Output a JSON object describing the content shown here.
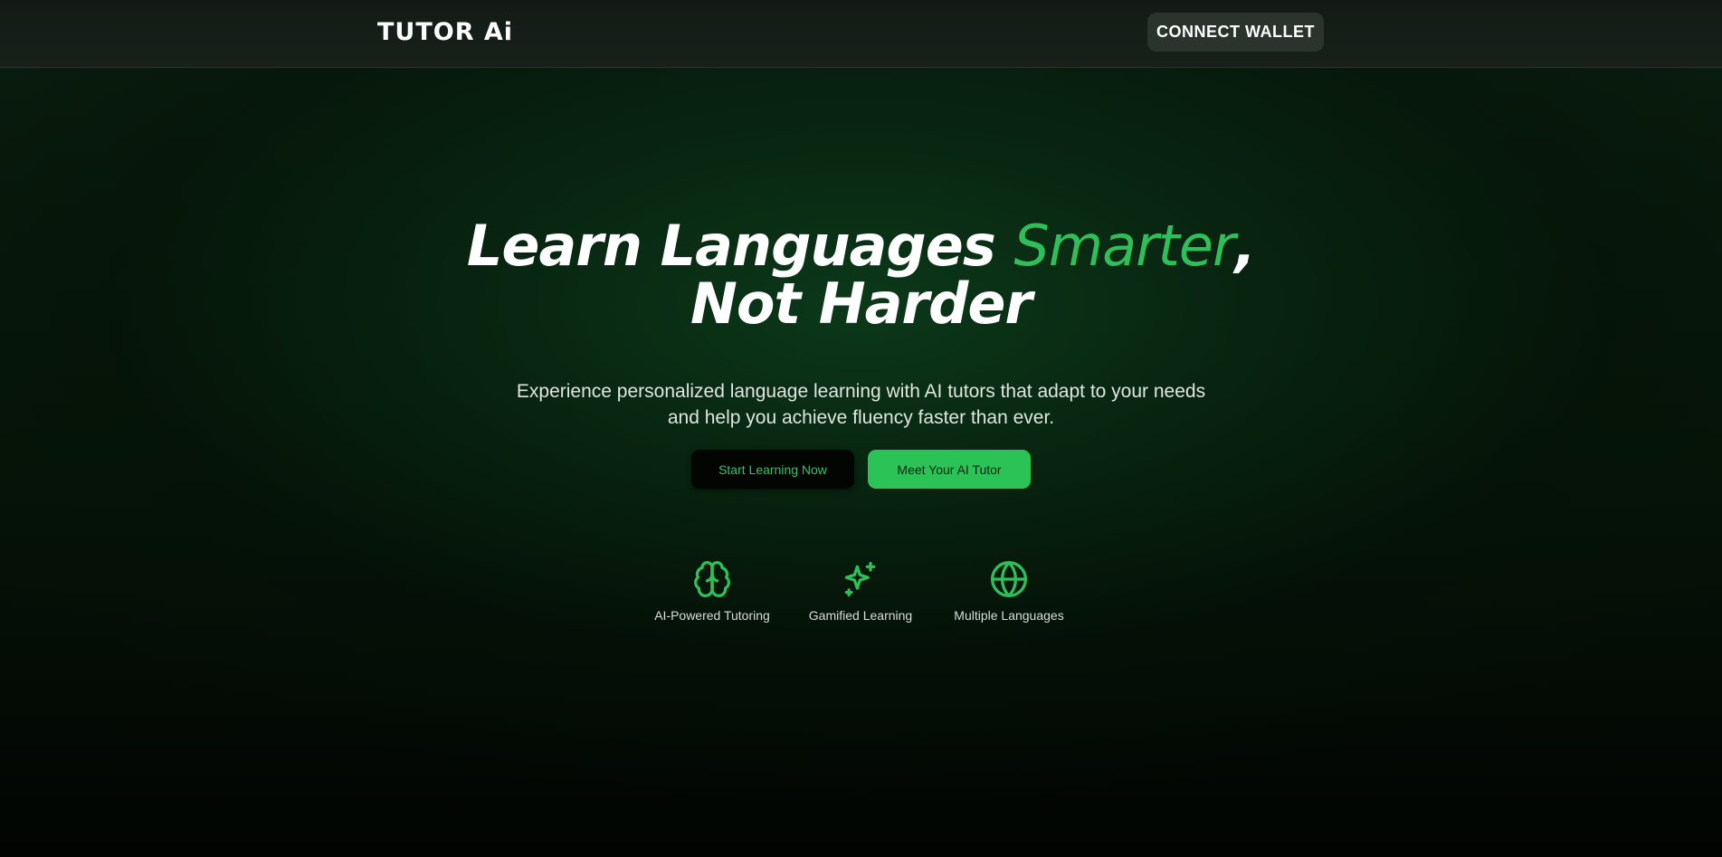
{
  "header": {
    "logo": "TUTOR Ai",
    "connect_wallet_label": "CONNECT WALLET"
  },
  "hero": {
    "title_part1": "Learn Languages ",
    "title_accent": "Smarter",
    "title_comma": ",",
    "title_line2": "Not Harder",
    "subtitle": "Experience personalized language learning with AI tutors that adapt to your needs and help you achieve fluency faster than ever.",
    "primary_button": "Start Learning Now",
    "secondary_button": "Meet Your AI Tutor"
  },
  "features": [
    {
      "icon": "brain-icon",
      "label": "AI-Powered Tutoring"
    },
    {
      "icon": "sparkles-icon",
      "label": "Gamified Learning"
    },
    {
      "icon": "globe-icon",
      "label": "Multiple Languages"
    }
  ],
  "colors": {
    "accent": "#2fbf5a",
    "background": "#061408",
    "button_green": "#2bc256",
    "header_bg": "#151d17"
  }
}
